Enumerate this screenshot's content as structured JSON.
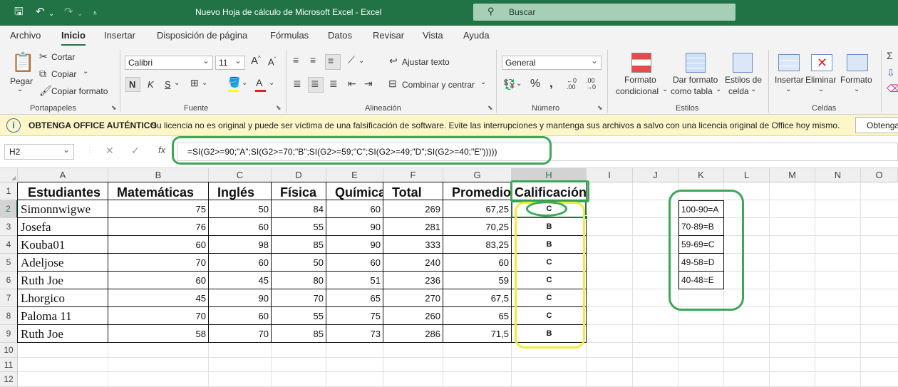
{
  "titlebar": {
    "icons": {
      "save": "save-icon",
      "undo": "undo-icon",
      "redo": "redo-icon",
      "customize": "customize-qat-icon"
    },
    "title": "Nuevo Hoja de cálculo de Microsoft Excel  -  Excel",
    "search_icon": "magnifier-icon",
    "search_label": "Buscar"
  },
  "menu": [
    "Archivo",
    "Inicio",
    "Insertar",
    "Disposición de página",
    "Fórmulas",
    "Datos",
    "Revisar",
    "Vista",
    "Ayuda"
  ],
  "ribbon": {
    "clipboard": {
      "paste": "Pegar",
      "cut": "Cortar",
      "copy": "Copiar",
      "format_painter": "Copiar formato",
      "group": "Portapapeles"
    },
    "font": {
      "family": "Calibri",
      "size": "11",
      "bold": "N",
      "italic": "K",
      "underline": "S",
      "group": "Fuente"
    },
    "alignment": {
      "wrap": "Ajustar texto",
      "merge": "Combinar y centrar",
      "group": "Alineación"
    },
    "number": {
      "format": "General",
      "group": "Número"
    },
    "styles": {
      "conditional_1": "Formato",
      "conditional_2": "condicional",
      "as_table_1": "Dar formato",
      "as_table_2": "como tabla",
      "cell_styles_1": "Estilos de",
      "cell_styles_2": "celda",
      "group": "Estilos"
    },
    "cells": {
      "insert": "Insertar",
      "delete": "Eliminar",
      "format": "Formato",
      "group": "Celdas"
    }
  },
  "license": {
    "title": "OBTENGA OFFICE AUTÉNTICO",
    "message": "Su licencia no es original y puede ser víctima de una falsificación de software. Evite las interrupciones y mantenga sus archivos a salvo con una licencia original de Office hoy mismo.",
    "button": "Obtenga"
  },
  "formula_bar": {
    "name_box": "H2",
    "fx": "fx",
    "formula": "=SI(G2>=90;\"A\";SI(G2>=70;\"B\";SI(G2>=59;\"C\";SI(G2>=49;\"D\";SI(G2>=40;\"E\")))))"
  },
  "sheet": {
    "columns": [
      "A",
      "B",
      "C",
      "D",
      "E",
      "F",
      "G",
      "H",
      "I",
      "J",
      "K",
      "L",
      "M",
      "N",
      "O"
    ],
    "rows": [
      "1",
      "2",
      "3",
      "4",
      "5",
      "6",
      "7",
      "8",
      "9",
      "10",
      "11",
      "12"
    ],
    "headers": [
      "Estudiantes",
      "Matemáticas",
      "Inglés",
      "Física",
      "Química",
      "Total",
      "Promedio",
      "Calificación"
    ],
    "data": [
      [
        "Simonnwigwe",
        "75",
        "50",
        "84",
        "60",
        "269",
        "67,25",
        "C"
      ],
      [
        "Josefa",
        "76",
        "60",
        "55",
        "90",
        "281",
        "70,25",
        "B"
      ],
      [
        "Kouba01",
        "60",
        "98",
        "85",
        "90",
        "333",
        "83,25",
        "B"
      ],
      [
        "Adeljose",
        "70",
        "60",
        "50",
        "60",
        "240",
        "60",
        "C"
      ],
      [
        "Ruth Joe",
        "60",
        "45",
        "80",
        "51",
        "236",
        "59",
        "C"
      ],
      [
        "Lhorgico",
        "45",
        "90",
        "70",
        "65",
        "270",
        "67,5",
        "C"
      ],
      [
        "Paloma 11",
        "70",
        "60",
        "55",
        "75",
        "260",
        "65",
        "C"
      ],
      [
        "Ruth Joe",
        "58",
        "70",
        "85",
        "73",
        "286",
        "71,5",
        "B"
      ]
    ],
    "scale": [
      "100-90=A",
      "70-89=B",
      "59-69=C",
      "49-58=D",
      "40-48=E"
    ],
    "annotation_colors": {
      "green": "#3aa855",
      "yellow": "#f0ec3c"
    }
  }
}
